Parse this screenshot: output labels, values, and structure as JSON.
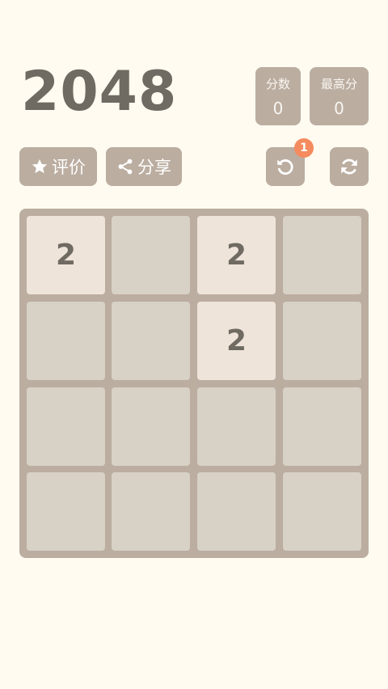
{
  "header": {
    "title": "2048",
    "score_label": "分数",
    "score_value": "0",
    "best_label": "最高分",
    "best_value": "0"
  },
  "toolbar": {
    "rate_label": "评价",
    "share_label": "分享",
    "undo_badge": "1"
  },
  "board": {
    "cells": [
      [
        "2",
        "",
        "2",
        ""
      ],
      [
        "",
        "",
        "2",
        ""
      ],
      [
        "",
        "",
        "",
        ""
      ],
      [
        "",
        "",
        "",
        ""
      ]
    ]
  },
  "colors": {
    "background": "#fffbf0",
    "board": "#bbada0",
    "empty_cell": "#d8d1c6",
    "tile_2": "#eee4da",
    "text_dark": "#6f6a62",
    "badge": "#f58b5e"
  },
  "icons": {
    "rate": "star-icon",
    "share": "share-icon",
    "undo": "undo-icon",
    "restart": "restart-icon"
  }
}
